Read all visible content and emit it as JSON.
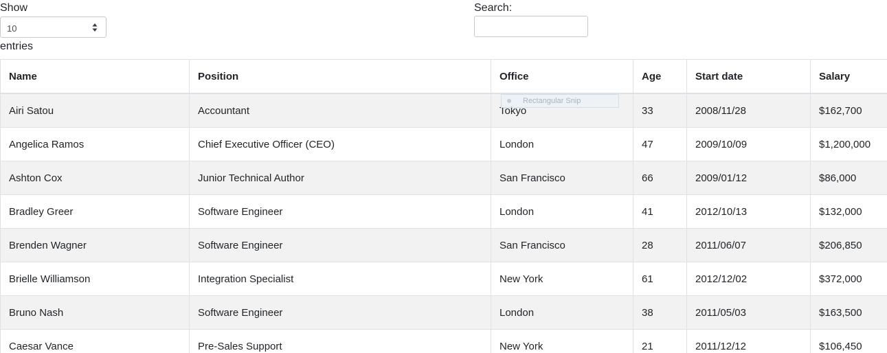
{
  "length_control": {
    "show_label": "Show",
    "selected": "10",
    "entries_label": "entries"
  },
  "search": {
    "label": "Search:",
    "value": "",
    "placeholder": ""
  },
  "table": {
    "headers": [
      "Name",
      "Position",
      "Office",
      "Age",
      "Start date",
      "Salary"
    ],
    "rows": [
      [
        "Airi Satou",
        "Accountant",
        "Tokyo",
        "33",
        "2008/11/28",
        "$162,700"
      ],
      [
        "Angelica Ramos",
        "Chief Executive Officer (CEO)",
        "London",
        "47",
        "2009/10/09",
        "$1,200,000"
      ],
      [
        "Ashton Cox",
        "Junior Technical Author",
        "San Francisco",
        "66",
        "2009/01/12",
        "$86,000"
      ],
      [
        "Bradley Greer",
        "Software Engineer",
        "London",
        "41",
        "2012/10/13",
        "$132,000"
      ],
      [
        "Brenden Wagner",
        "Software Engineer",
        "San Francisco",
        "28",
        "2011/06/07",
        "$206,850"
      ],
      [
        "Brielle Williamson",
        "Integration Specialist",
        "New York",
        "61",
        "2012/12/02",
        "$372,000"
      ],
      [
        "Bruno Nash",
        "Software Engineer",
        "London",
        "38",
        "2011/05/03",
        "$163,500"
      ],
      [
        "Caesar Vance",
        "Pre-Sales Support",
        "New York",
        "21",
        "2011/12/12",
        "$106,450"
      ]
    ]
  },
  "overlay": {
    "snip_label": "Rectangular Snip"
  },
  "colors": {
    "stripe": "#f2f2f2",
    "border": "#dee2e6",
    "text": "#212529"
  }
}
